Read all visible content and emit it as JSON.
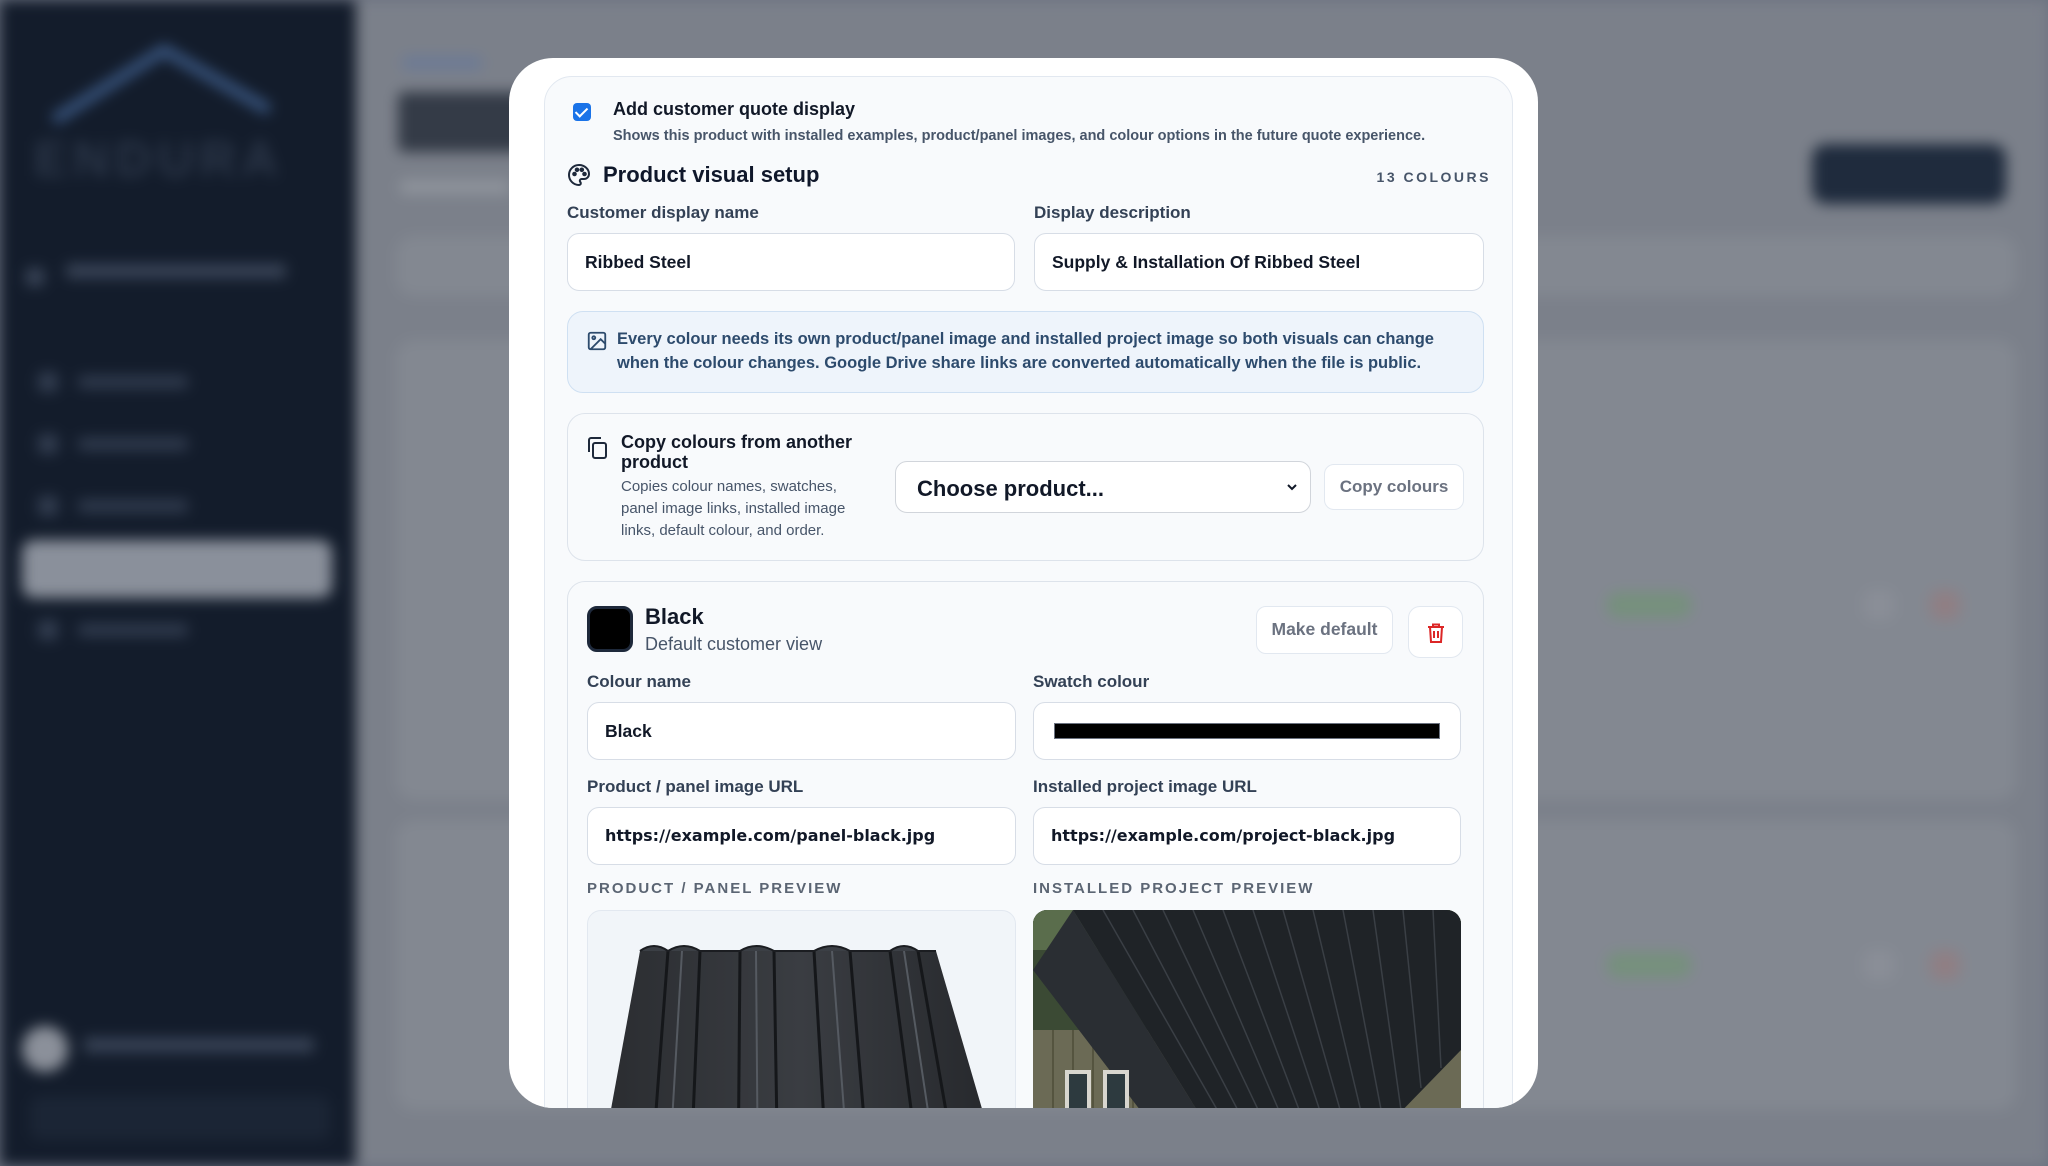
{
  "modal": {
    "quote_display": {
      "checked": true,
      "title": "Add customer quote display",
      "description": "Shows this product with installed examples, product/panel images, and colour options in the future quote experience."
    },
    "setup": {
      "title": "Product visual setup",
      "colour_count": "13 COLOURS"
    },
    "fields": {
      "display_name_label": "Customer display name",
      "display_name_value": "Ribbed Steel",
      "description_label": "Display description",
      "description_value": "Supply & Installation Of Ribbed Steel"
    },
    "info_note": "Every colour needs its own product/panel image and installed project image so both visuals can change when the colour changes. Google Drive share links are converted automatically when the file is public.",
    "copy_colours": {
      "title": "Copy colours from another product",
      "description": "Copies colour names, swatches, panel image links, installed image links, default colour, and order.",
      "select_value": "Choose product...",
      "button_label": "Copy colours"
    },
    "colour_card": {
      "name": "Black",
      "subtitle": "Default customer view",
      "swatch_hex": "#000000",
      "make_default_label": "Make default",
      "colour_name_label": "Colour name",
      "colour_name_value": "Black",
      "swatch_label": "Swatch colour",
      "panel_url_label": "Product / panel image URL",
      "panel_url_value": "https://example.com/panel-black.jpg",
      "project_url_label": "Installed project image URL",
      "project_url_value": "https://example.com/project-black.jpg",
      "panel_preview_label": "PRODUCT / PANEL PREVIEW",
      "project_preview_label": "INSTALLED PROJECT PREVIEW"
    }
  },
  "colors": {
    "accent": "#1a73e8",
    "delete": "#dc2626",
    "info_text": "#2d4b6d",
    "sidebar": "#131c2b"
  }
}
